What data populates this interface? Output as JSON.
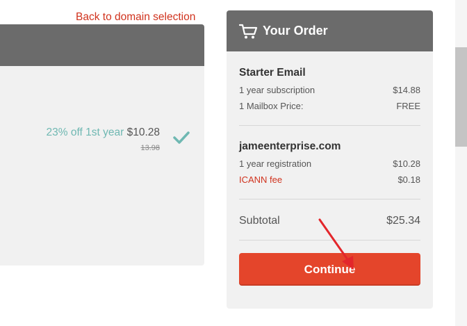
{
  "back_link": "Back to domain selection",
  "domain_offer": {
    "discount": "23% off 1st year",
    "price": "$10.28",
    "old_price": "13.98"
  },
  "order": {
    "title": "Your Order",
    "items": [
      {
        "name": "Starter Email",
        "lines": [
          {
            "label": "1 year subscription",
            "value": "$14.88"
          },
          {
            "label": "1 Mailbox Price:",
            "value": "FREE"
          }
        ]
      },
      {
        "name": "jameenterprise.com",
        "lines": [
          {
            "label": "1 year registration",
            "value": "$10.28"
          },
          {
            "label": "ICANN fee",
            "value": "$0.18"
          }
        ]
      }
    ],
    "subtotal_label": "Subtotal",
    "subtotal_value": "$25.34",
    "continue_label": "Continue"
  },
  "colors": {
    "accent": "#e4452b",
    "link_red": "#d0321d",
    "header_gray": "#6b6b6b",
    "discount_teal": "#6fb8b2"
  },
  "icons": [
    "cart-icon",
    "checkmark-icon",
    "annotation-arrow"
  ]
}
